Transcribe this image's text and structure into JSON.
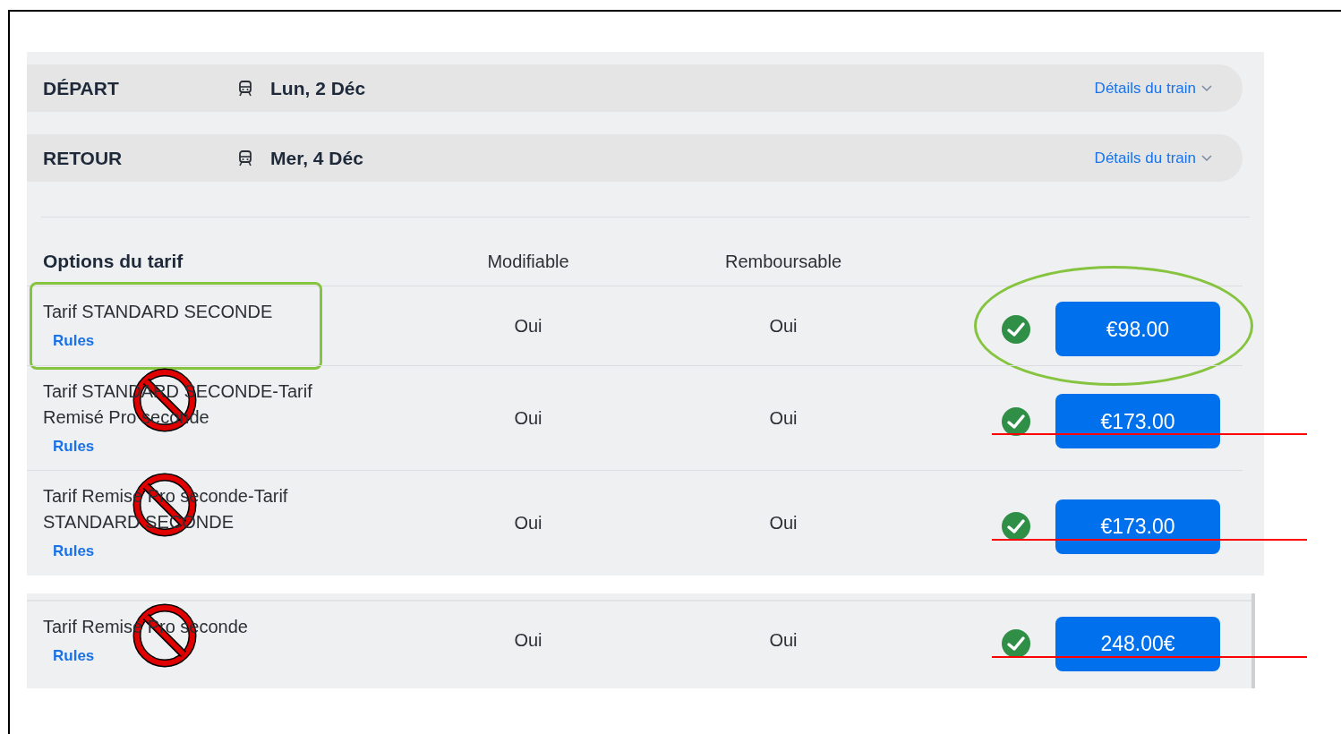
{
  "legs": [
    {
      "label": "DÉPART",
      "date": "Lun, 2 Déc",
      "details": "Détails du train"
    },
    {
      "label": "RETOUR",
      "date": "Mer, 4 Déc",
      "details": "Détails du train"
    }
  ],
  "fares": {
    "columns": [
      "Options du tarif",
      "Modifiable",
      "Remboursable"
    ],
    "rows": [
      {
        "name": "Tarif STANDARD SECONDE",
        "rules": "Rules",
        "modifiable": "Oui",
        "remboursable": "Oui",
        "price": "€98.00",
        "highlighted": true,
        "struck": false
      },
      {
        "name": "Tarif STANDARD SECONDE-Tarif Remisé Pro seconde",
        "rules": "Rules",
        "modifiable": "Oui",
        "remboursable": "Oui",
        "price": "€173.00",
        "highlighted": false,
        "struck": true
      },
      {
        "name": "Tarif Remisé Pro seconde-Tarif STANDARD SECONDE",
        "rules": "Rules",
        "modifiable": "Oui",
        "remboursable": "Oui",
        "price": "€173.00",
        "highlighted": false,
        "struck": true
      }
    ]
  },
  "extra_fare": {
    "name": "Tarif Remisé Pro seconde",
    "rules": "Rules",
    "modifiable": "Oui",
    "remboursable": "Oui",
    "price": "248.00€",
    "highlighted": false,
    "struck": true
  }
}
